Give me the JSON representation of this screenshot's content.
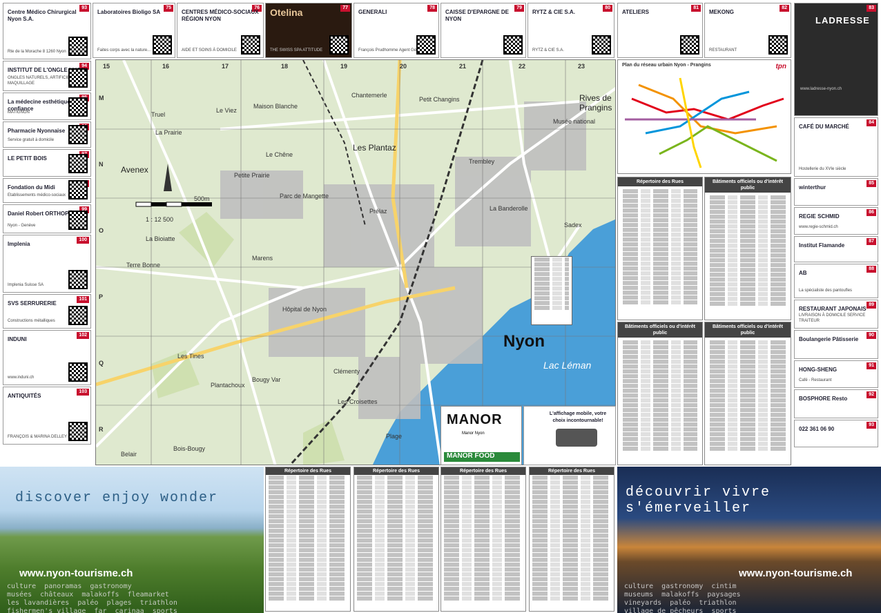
{
  "left_ads": [
    {
      "num": "93",
      "name": "Centre Médico Chirurgical Nyon S.A.",
      "sub": "Rte de la Morache 8 1260 Nyon"
    },
    {
      "num": "94",
      "name": "INSTITUT DE L'ONGLE NYON",
      "sub": "ONGLES NATURELS, ARTIFICIELS - MAQUILLAGE"
    },
    {
      "num": "95",
      "name": "La médecine esthétique en confiance",
      "sub": "MATIGNON"
    },
    {
      "num": "96",
      "name": "Pharmacie Nyonnaise",
      "sub": "Service gratuit à domicile"
    },
    {
      "num": "97",
      "name": "LE PETIT BOIS",
      "sub": ""
    },
    {
      "num": "98",
      "name": "Fondation du Midi",
      "sub": "Etablissements médico-sociaux"
    },
    {
      "num": "99",
      "name": "Daniel Robert ORTHOPÉDIE",
      "sub": "Nyon - Genève"
    },
    {
      "num": "100",
      "name": "Implenia",
      "sub": "Implenia Suisse SA"
    },
    {
      "num": "101",
      "name": "SVS SERRURERIE",
      "sub": "Constructions métalliques",
      "phone": "022 755 19 66",
      "url": "www.svs-sa.ch"
    },
    {
      "num": "102",
      "name": "INDUNI",
      "sub": "www.induni.ch"
    },
    {
      "num": "103",
      "name": "ANTIQUITÉS",
      "sub": "FRANÇOIS & MARINA DELLEY - PALZAKI"
    }
  ],
  "top_ads": [
    {
      "num": "75",
      "name": "Laboratoires Bioligo SA",
      "tag": "Faites corps avec la nature..."
    },
    {
      "num": "76",
      "name": "CENTRES MÉDICO-SOCIAUX RÉGION NYON",
      "tag": "AIDE ET SOINS À DOMICILE"
    },
    {
      "num": "77",
      "name": "Otelina",
      "tag": "THE SWISS SPA ATTITUDE"
    },
    {
      "num": "78",
      "name": "GENERALI",
      "tag": "François Prudhomme Agent Général"
    },
    {
      "num": "79",
      "name": "CAISSE D'EPARGNE DE NYON",
      "tag": ""
    },
    {
      "num": "80",
      "name": "RYTZ & CIE S.A.",
      "tag": "RYTZ & CIE S.A."
    },
    {
      "num": "81",
      "name": "ATELIERS",
      "tag": ""
    },
    {
      "num": "82",
      "name": "MEKONG",
      "tag": "RESTAURANT"
    },
    {
      "num": "83",
      "name": "LADRESSE",
      "tag": "www.ladresse-nyon.ch"
    }
  ],
  "right_ads": [
    {
      "num": "84",
      "name": "CAFÉ DU MARCHÉ",
      "sub": "Hostellerie du XVIe siècle"
    },
    {
      "num": "85",
      "name": "winterthur",
      "sub": ""
    },
    {
      "num": "86",
      "name": "REGIE SCHMID",
      "sub": "www.regie-schmid.ch"
    },
    {
      "num": "87",
      "name": "Institut Flamande",
      "sub": ""
    },
    {
      "num": "88",
      "name": "AB",
      "sub": "La spécialiste des pantoufles"
    },
    {
      "num": "89",
      "name": "RESTAURANT JAPONAIS",
      "sub": "LIVRAISON À DOMICILE SERVICE TRAITEUR"
    },
    {
      "num": "90",
      "name": "Boulangerie Pâtisserie",
      "sub": ""
    },
    {
      "num": "91",
      "name": "HONG-SHENG",
      "sub": "Café - Restaurant"
    },
    {
      "num": "92",
      "name": "BOSPHORE Resto",
      "sub": ""
    },
    {
      "num": "93",
      "name": "022 361 06 90",
      "sub": ""
    }
  ],
  "map": {
    "city": "Nyon",
    "lake": "Lac Léman",
    "scale": "1 : 12 500",
    "scale_bar": "500m",
    "places": [
      "Truel",
      "Le Viez",
      "Maison Blanche",
      "Chantemerle",
      "Petit Changins",
      "Rives de Prangins",
      "La Prairie",
      "Avenex",
      "Le Chêne",
      "Les Plantaz",
      "Trembley",
      "Petite Prairie",
      "Musée national",
      "Prélaz",
      "La Banderolle",
      "La Bioiatte",
      "Sadex",
      "Terre Bonne",
      "Marens",
      "Hôpital de Nyon",
      "Clémenty",
      "Les Tines",
      "Bougy Var",
      "Plantachoux",
      "Les Croisettes",
      "Plage",
      "Belair",
      "Bois-Bougy",
      "Parc de Mangette"
    ],
    "grid_top": [
      "15",
      "16",
      "17",
      "18",
      "19",
      "20",
      "21",
      "22",
      "23"
    ],
    "grid_side": [
      "M",
      "N",
      "O",
      "P",
      "Q",
      "R"
    ]
  },
  "tpn": {
    "title": "Plan du réseau urbain  Nyon - Prangins",
    "logo": "tpn"
  },
  "right_panels": [
    {
      "title": "Répertoire des Rues"
    },
    {
      "title": "Bâtiments officiels ou d'intérêt public"
    },
    {
      "title": "Bâtiments officiels ou d'intérêt public"
    },
    {
      "title": "Bâtiments officiels ou d'intérêt public"
    }
  ],
  "manor": {
    "logo": "MANOR",
    "sub": "Manor Nyon",
    "food": "MANOR FOOD",
    "caption": "L'affichage mobile, votre choix incontournable!"
  },
  "bottom": {
    "left_tagline": "discover  enjoy  wonder",
    "right_tagline": "découvrir  vivre  s'émerveiller",
    "url": "www.nyon-tourisme.ch",
    "index_title": "Répertoire des Rues",
    "left_words": "culture  panoramas  gastronomy\nmusées  châteaux  malakoffs  fleamarket\nles lavandières  paléo  plages  triathlon\nfishermen's village  far  carinaa  sports",
    "right_words": "culture  gastronomy  cintim\nmuseums  malakoffs  paysages\nvineyards  paléo  triathlon\nvillage de pêcheurs  sports"
  }
}
